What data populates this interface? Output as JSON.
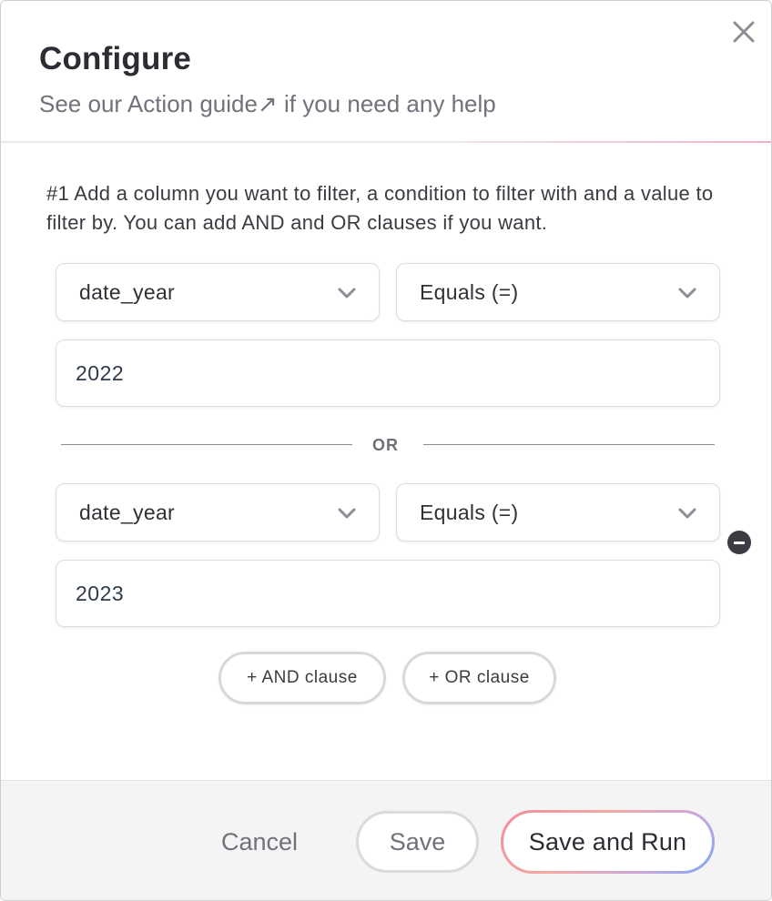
{
  "header": {
    "title": "Configure",
    "subtitle_prefix": "See our ",
    "guide_link": "Action guide",
    "link_arrow": "↗",
    "subtitle_suffix": " if you need any help",
    "close_icon": "close-icon"
  },
  "instructions": "#1 Add a column you want to filter, a condition to filter with and a value to filter by. You can add AND and OR clauses if you want.",
  "filters": [
    {
      "column": "date_year",
      "condition": "Equals (=)",
      "value": "2022"
    },
    {
      "column": "date_year",
      "condition": "Equals (=)",
      "value": "2023"
    }
  ],
  "separator": "OR",
  "clause_buttons": {
    "and_label": "+ AND clause",
    "or_label": "+ OR clause"
  },
  "footer": {
    "cancel_label": "Cancel",
    "save_label": "Save",
    "save_run_label": "Save and Run"
  },
  "colors": {
    "text": "#2b2d33",
    "muted": "#70737b",
    "gradient_start": "#f28a9b",
    "gradient_end": "#7aa8ee"
  }
}
